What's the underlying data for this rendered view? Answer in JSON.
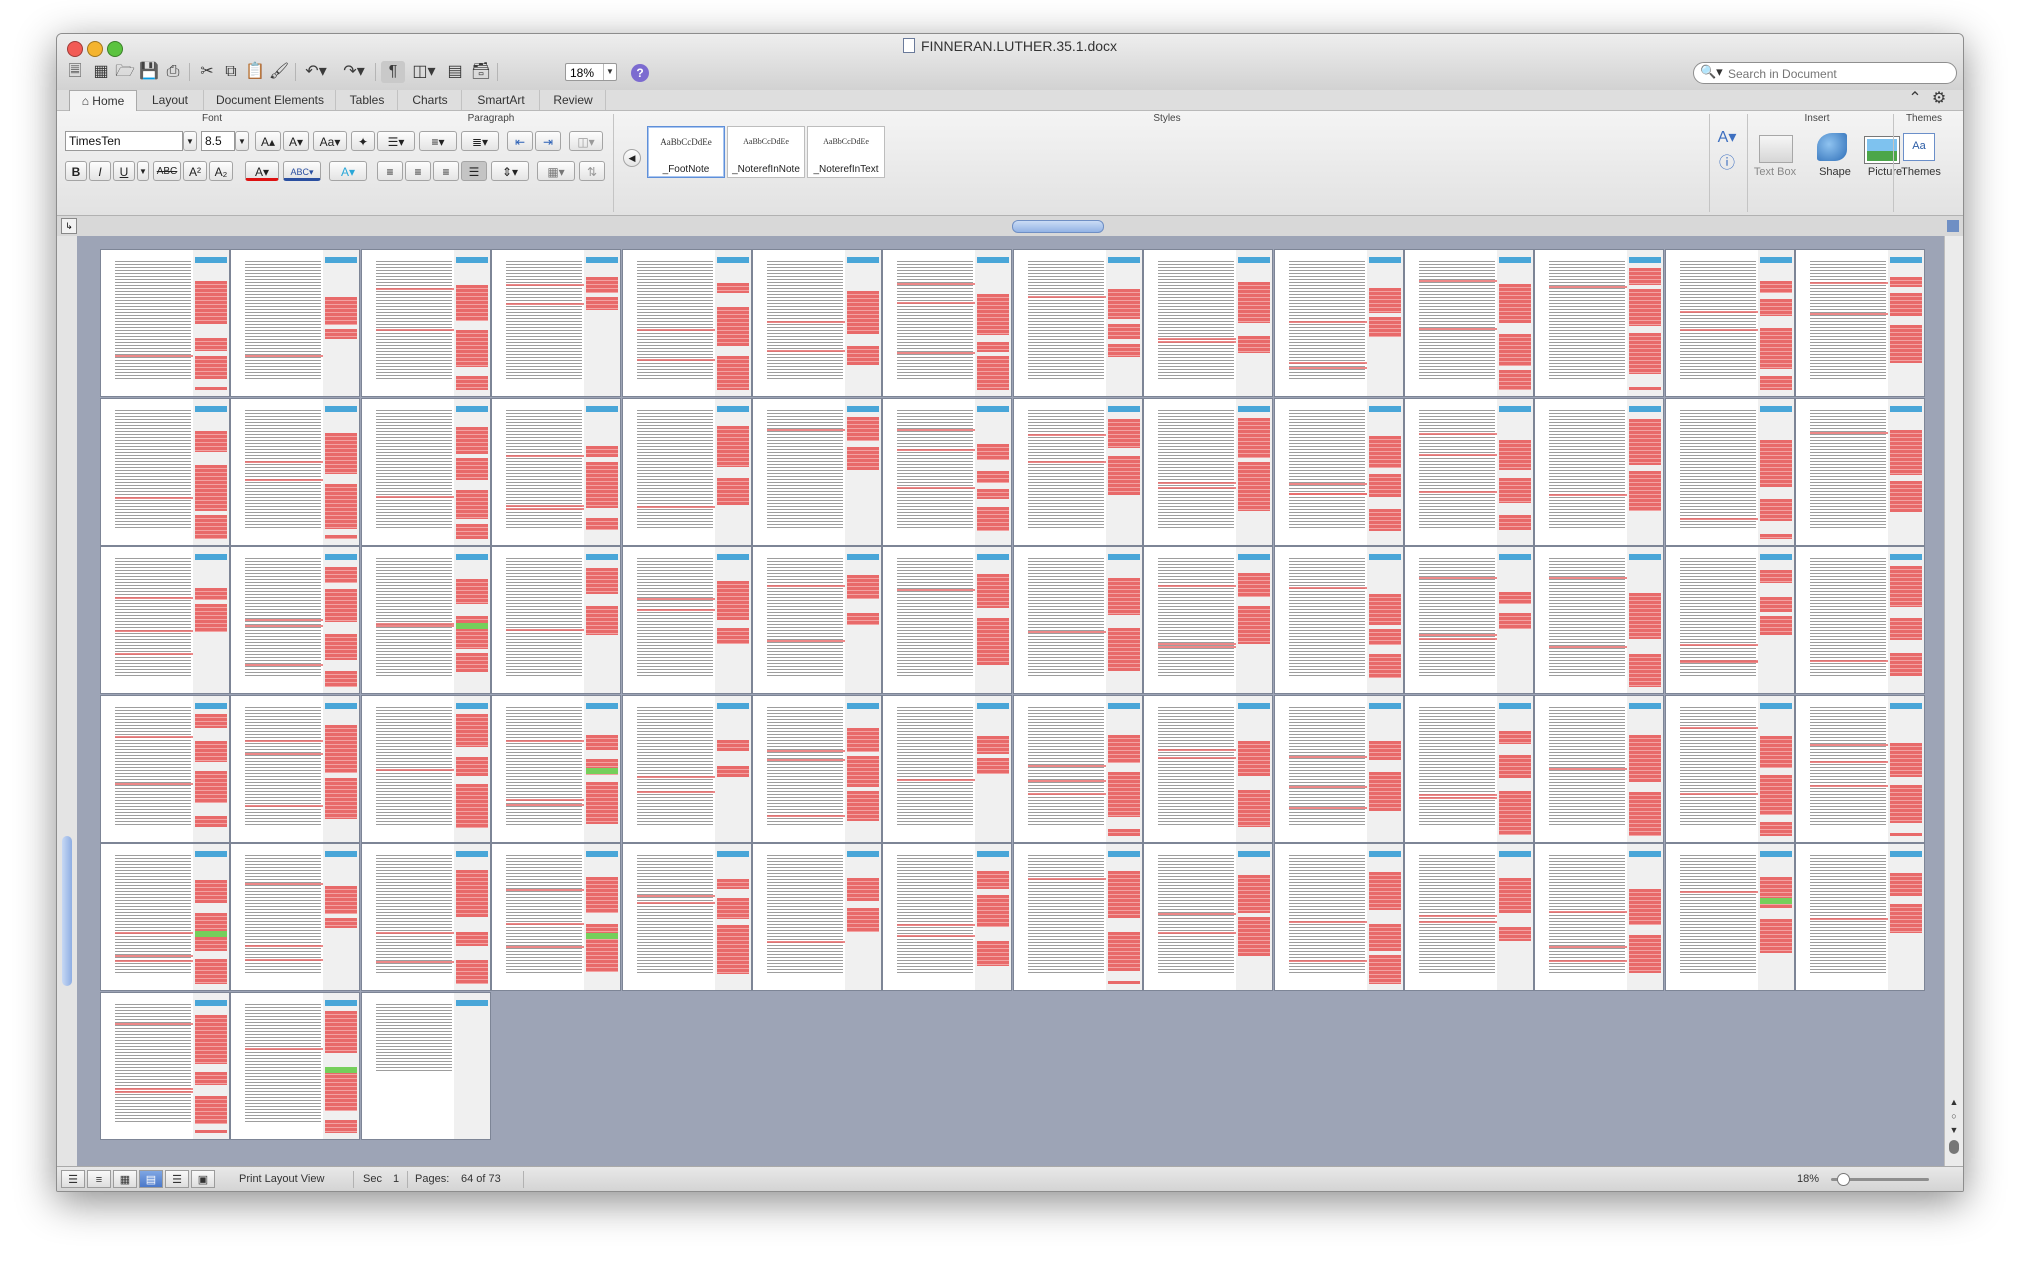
{
  "window": {
    "title": "FINNERAN.LUTHER.35.1.docx"
  },
  "toolbar": {
    "zoom": "18%",
    "search_placeholder": "Search in Document",
    "help": "?"
  },
  "tabs": [
    "Home",
    "Layout",
    "Document Elements",
    "Tables",
    "Charts",
    "SmartArt",
    "Review"
  ],
  "ribbon": {
    "groups": {
      "font": "Font",
      "paragraph": "Paragraph",
      "styles": "Styles",
      "insert": "Insert",
      "themes": "Themes"
    },
    "font_name": "TimesTen",
    "font_size": "8.5",
    "format_buttons": [
      "B",
      "I",
      "U",
      "ABC",
      "A²",
      "A₂"
    ],
    "styles": [
      {
        "sample": "AaBbCcDdEe",
        "name": "_FootNote"
      },
      {
        "sample": "AaBbCcDdEe",
        "name": "_NoterefInNote"
      },
      {
        "sample": "AaBbCcDdEe",
        "name": "_NoterefInText"
      }
    ],
    "insert": [
      {
        "label": "Text Box"
      },
      {
        "label": "Shape"
      },
      {
        "label": "Picture"
      }
    ],
    "themes_label": "Themes"
  },
  "thumbnails": {
    "columns": 14,
    "count": 73,
    "accent_colors": {
      "markup": "#e86a6a",
      "comment": "#49a6d8",
      "highlight": "#75cf5b"
    }
  },
  "status": {
    "view_name": "Print Layout View",
    "section_label": "Sec",
    "section_value": "1",
    "pages_label": "Pages:",
    "pages_value": "64 of 73",
    "zoom_percent": "18%"
  }
}
